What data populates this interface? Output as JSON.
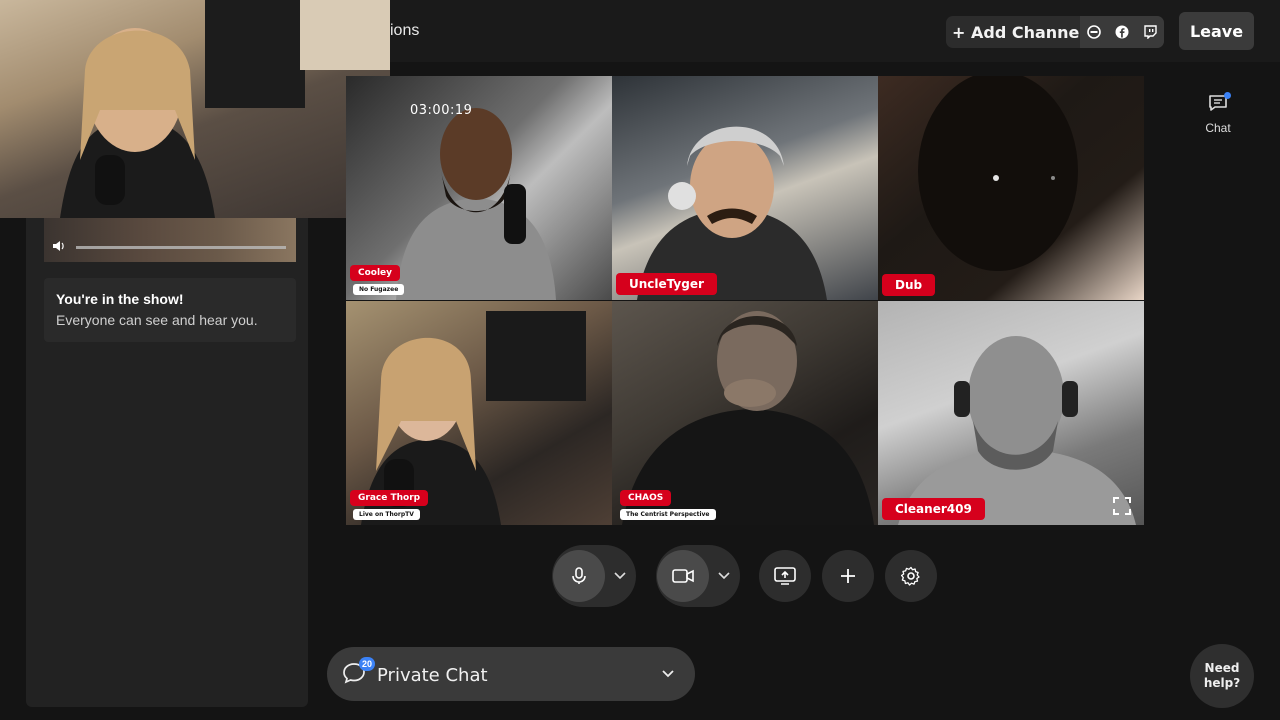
{
  "header": {
    "title_partial": "ions",
    "add_channels_label": "+ Add Channels",
    "leave_label": "Leave",
    "channel_icons": [
      "restream-icon",
      "facebook-icon",
      "twitch-icon"
    ]
  },
  "right_rail": {
    "chat_label": "Chat"
  },
  "left_panel": {
    "status_title": "You're in the show!",
    "status_sub": "Everyone can see and hear you."
  },
  "stage": {
    "timer": "03:00:19",
    "participants": [
      {
        "name": "Cooley",
        "subtitle": "No Fugazee"
      },
      {
        "name": "UncleTyger",
        "subtitle": ""
      },
      {
        "name": "Dub",
        "subtitle": ""
      },
      {
        "name": "Grace Thorp",
        "subtitle": "Live on ThorpTV"
      },
      {
        "name": "CHAOS",
        "subtitle": "The Centrist Perspective"
      },
      {
        "name": "Cleaner409",
        "subtitle": ""
      }
    ]
  },
  "controls": [
    "mic-icon",
    "camera-icon",
    "share-screen-icon",
    "plus-icon",
    "gear-icon"
  ],
  "private_chat": {
    "label": "Private Chat",
    "badge": "20"
  },
  "help": {
    "line1": "Need",
    "line2": "help?"
  },
  "colors": {
    "accent_red": "#d6001c",
    "badge_blue": "#3b82f6"
  }
}
